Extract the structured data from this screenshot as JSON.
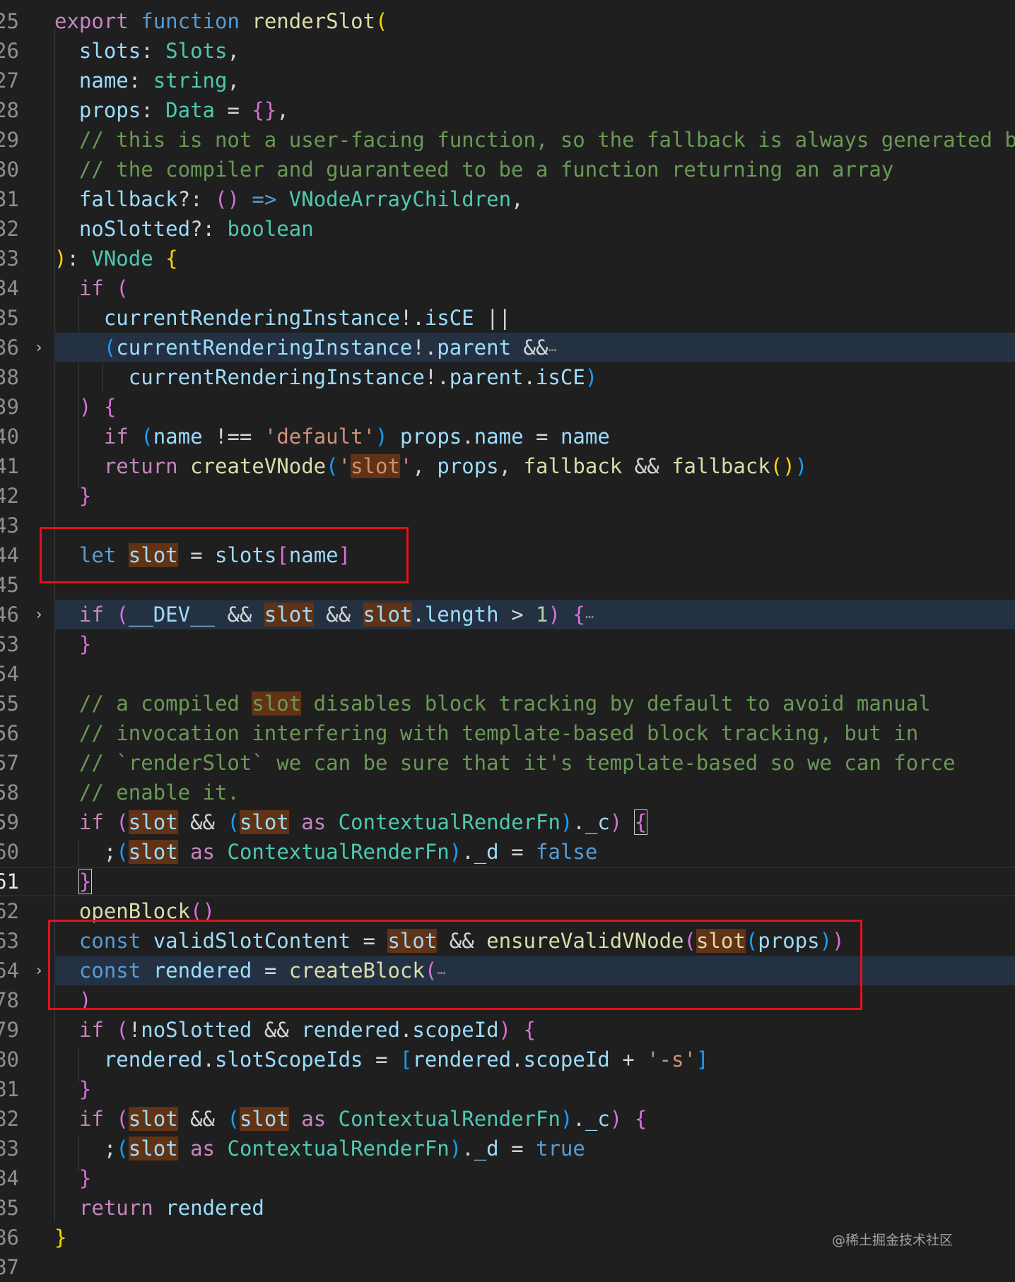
{
  "editor": {
    "watermark": "@稀土掘金技术社区",
    "lines": [
      {
        "no": "25",
        "code": "export function renderSlot("
      },
      {
        "no": "26",
        "code": "  slots: Slots,"
      },
      {
        "no": "27",
        "code": "  name: string,"
      },
      {
        "no": "28",
        "code": "  props: Data = {},"
      },
      {
        "no": "29",
        "code": "  // this is not a user-facing function, so the fallback is always generated by"
      },
      {
        "no": "30",
        "code": "  // the compiler and guaranteed to be a function returning an array"
      },
      {
        "no": "31",
        "code": "  fallback?: () => VNodeArrayChildren,"
      },
      {
        "no": "32",
        "code": "  noSlotted?: boolean"
      },
      {
        "no": "33",
        "code": "): VNode {"
      },
      {
        "no": "34",
        "code": "  if ("
      },
      {
        "no": "35",
        "code": "    currentRenderingInstance!.isCE ||"
      },
      {
        "no": "36",
        "code": "    (currentRenderingInstance!.parent &&⋯",
        "folded": true
      },
      {
        "no": "38",
        "code": "      currentRenderingInstance!.parent.isCE)"
      },
      {
        "no": "39",
        "code": "  ) {"
      },
      {
        "no": "40",
        "code": "    if (name !== 'default') props.name = name"
      },
      {
        "no": "41",
        "code": "    return createVNode('slot', props, fallback && fallback())"
      },
      {
        "no": "42",
        "code": "  }"
      },
      {
        "no": "43",
        "code": ""
      },
      {
        "no": "44",
        "code": "  let slot = slots[name]"
      },
      {
        "no": "45",
        "code": ""
      },
      {
        "no": "46",
        "code": "  if (__DEV__ && slot && slot.length > 1) {⋯",
        "folded": true
      },
      {
        "no": "53",
        "code": "  }"
      },
      {
        "no": "54",
        "code": ""
      },
      {
        "no": "55",
        "code": "  // a compiled slot disables block tracking by default to avoid manual"
      },
      {
        "no": "56",
        "code": "  // invocation interfering with template-based block tracking, but in"
      },
      {
        "no": "57",
        "code": "  // `renderSlot` we can be sure that it's template-based so we can force"
      },
      {
        "no": "58",
        "code": "  // enable it."
      },
      {
        "no": "59",
        "code": "  if (slot && (slot as ContextualRenderFn)._c) {"
      },
      {
        "no": "60",
        "code": "    ;(slot as ContextualRenderFn)._d = false"
      },
      {
        "no": "61",
        "code": "  }",
        "current": true
      },
      {
        "no": "62",
        "code": "  openBlock()"
      },
      {
        "no": "63",
        "code": "  const validSlotContent = slot && ensureValidVNode(slot(props))"
      },
      {
        "no": "64",
        "code": "  const rendered = createBlock(⋯",
        "folded": true
      },
      {
        "no": "78",
        "code": "  )"
      },
      {
        "no": "79",
        "code": "  if (!noSlotted && rendered.scopeId) {"
      },
      {
        "no": "80",
        "code": "    rendered.slotScopeIds = [rendered.scopeId + '-s']"
      },
      {
        "no": "81",
        "code": "  }"
      },
      {
        "no": "82",
        "code": "  if (slot && (slot as ContextualRenderFn)._c) {"
      },
      {
        "no": "83",
        "code": "    ;(slot as ContextualRenderFn)._d = true"
      },
      {
        "no": "84",
        "code": "  }"
      },
      {
        "no": "85",
        "code": "  return rendered"
      },
      {
        "no": "86",
        "code": "}"
      },
      {
        "no": "87",
        "code": ""
      }
    ]
  }
}
